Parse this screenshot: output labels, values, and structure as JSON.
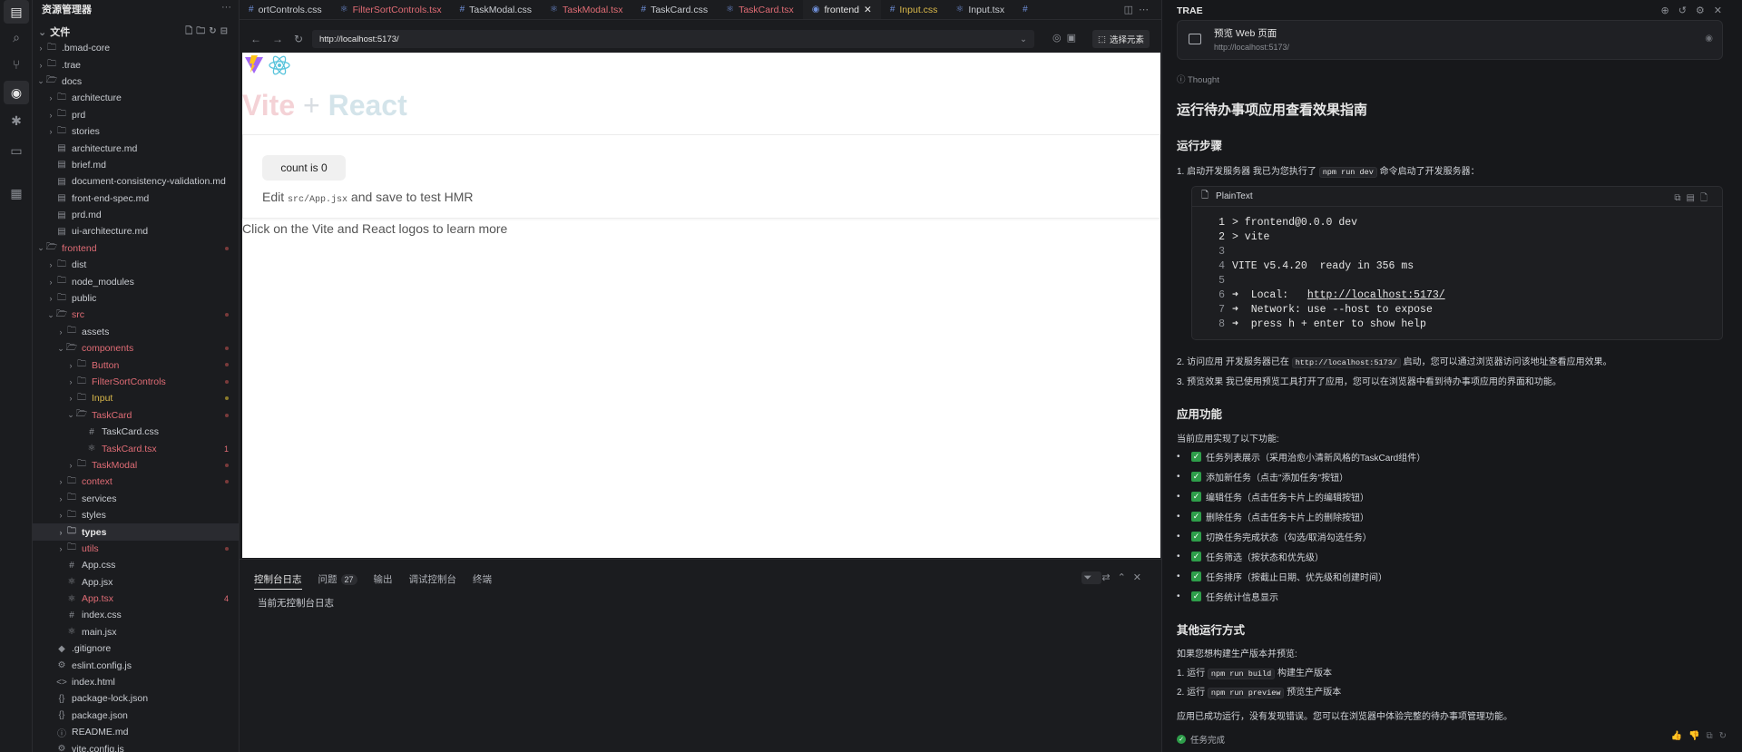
{
  "activity": {
    "icons": [
      "files-icon",
      "search-icon",
      "source-control-icon",
      "preview-eye-icon",
      "debug-icon",
      "remote-icon",
      "extensions-icon"
    ]
  },
  "sidebar": {
    "title": "资源管理器",
    "section": "文件",
    "items": [
      {
        "label": ".bmad-core",
        "indent": 0,
        "type": "folder"
      },
      {
        "label": ".trae",
        "indent": 0,
        "type": "folder"
      },
      {
        "label": "docs",
        "indent": 0,
        "type": "folder-open"
      },
      {
        "label": "architecture",
        "indent": 1,
        "type": "folder"
      },
      {
        "label": "prd",
        "indent": 1,
        "type": "folder"
      },
      {
        "label": "stories",
        "indent": 1,
        "type": "folder"
      },
      {
        "label": "architecture.md",
        "indent": 1,
        "type": "md"
      },
      {
        "label": "brief.md",
        "indent": 1,
        "type": "md"
      },
      {
        "label": "document-consistency-validation.md",
        "indent": 1,
        "type": "md"
      },
      {
        "label": "front-end-spec.md",
        "indent": 1,
        "type": "md"
      },
      {
        "label": "prd.md",
        "indent": 1,
        "type": "md"
      },
      {
        "label": "ui-architecture.md",
        "indent": 1,
        "type": "md"
      },
      {
        "label": "frontend",
        "indent": 0,
        "type": "folder-open",
        "color": "red",
        "dot": "r"
      },
      {
        "label": "dist",
        "indent": 1,
        "type": "folder"
      },
      {
        "label": "node_modules",
        "indent": 1,
        "type": "folder"
      },
      {
        "label": "public",
        "indent": 1,
        "type": "folder"
      },
      {
        "label": "src",
        "indent": 1,
        "type": "folder-open",
        "color": "red",
        "dot": "r"
      },
      {
        "label": "assets",
        "indent": 2,
        "type": "folder"
      },
      {
        "label": "components",
        "indent": 2,
        "type": "folder-open",
        "color": "red",
        "dot": "r"
      },
      {
        "label": "Button",
        "indent": 3,
        "type": "folder",
        "color": "red",
        "dot": "r"
      },
      {
        "label": "FilterSortControls",
        "indent": 3,
        "type": "folder",
        "color": "red",
        "dot": "r"
      },
      {
        "label": "Input",
        "indent": 3,
        "type": "folder",
        "color": "yellow",
        "dot": "y"
      },
      {
        "label": "TaskCard",
        "indent": 3,
        "type": "folder-open",
        "color": "red",
        "dot": "r"
      },
      {
        "label": "TaskCard.css",
        "indent": 4,
        "type": "css"
      },
      {
        "label": "TaskCard.tsx",
        "indent": 4,
        "type": "tsx",
        "color": "red",
        "num": "1"
      },
      {
        "label": "TaskModal",
        "indent": 3,
        "type": "folder",
        "color": "red",
        "dot": "r"
      },
      {
        "label": "context",
        "indent": 2,
        "type": "folder",
        "color": "red",
        "dot": "r"
      },
      {
        "label": "services",
        "indent": 2,
        "type": "folder"
      },
      {
        "label": "styles",
        "indent": 2,
        "type": "folder"
      },
      {
        "label": "types",
        "indent": 2,
        "type": "folder",
        "bold": true,
        "sel": true
      },
      {
        "label": "utils",
        "indent": 2,
        "type": "folder",
        "color": "red",
        "dot": "r"
      },
      {
        "label": "App.css",
        "indent": 2,
        "type": "css"
      },
      {
        "label": "App.jsx",
        "indent": 2,
        "type": "tsx"
      },
      {
        "label": "App.tsx",
        "indent": 2,
        "type": "tsx",
        "color": "red",
        "num": "4"
      },
      {
        "label": "index.css",
        "indent": 2,
        "type": "css"
      },
      {
        "label": "main.jsx",
        "indent": 2,
        "type": "tsx"
      },
      {
        "label": ".gitignore",
        "indent": 1,
        "type": "git"
      },
      {
        "label": "eslint.config.js",
        "indent": 1,
        "type": "js"
      },
      {
        "label": "index.html",
        "indent": 1,
        "type": "html"
      },
      {
        "label": "package-lock.json",
        "indent": 1,
        "type": "json"
      },
      {
        "label": "package.json",
        "indent": 1,
        "type": "json"
      },
      {
        "label": "README.md",
        "indent": 1,
        "type": "info"
      },
      {
        "label": "vite.config.js",
        "indent": 1,
        "type": "js"
      }
    ]
  },
  "tabs": [
    {
      "label": "ortControls.css",
      "color": "",
      "icon": "#"
    },
    {
      "label": "FilterSortControls.tsx",
      "color": "red",
      "icon": "⚛"
    },
    {
      "label": "TaskModal.css",
      "color": "",
      "icon": "#"
    },
    {
      "label": "TaskModal.tsx",
      "color": "red",
      "icon": "⚛"
    },
    {
      "label": "TaskCard.css",
      "color": "",
      "icon": "#"
    },
    {
      "label": "TaskCard.tsx",
      "color": "red",
      "icon": "⚛"
    },
    {
      "label": "frontend",
      "color": "active",
      "icon": "◉"
    },
    {
      "label": "Input.css",
      "color": "yellow",
      "icon": "#"
    },
    {
      "label": "Input.tsx",
      "color": "",
      "icon": "⚛"
    },
    {
      "label": "",
      "color": "",
      "icon": "#"
    }
  ],
  "browser": {
    "url": "http://localhost:5173/",
    "pick_label": "选择元素"
  },
  "page": {
    "title_vite": "Vite",
    "title_plus": "+",
    "title_react": "React",
    "count_label": "count is 0",
    "edit_pre": "Edit ",
    "edit_code": "src/App.jsx",
    "edit_post": " and save to test HMR",
    "learn": "Click on the Vite and React logos to learn more"
  },
  "panel": {
    "tabs": [
      "控制台日志",
      "问题",
      "输出",
      "调试控制台",
      "终端"
    ],
    "problems_count": "27",
    "empty": "当前无控制台日志"
  },
  "assistant": {
    "header": "TRAE",
    "preview_title": "预览 Web 页面",
    "preview_url": "http://localhost:5173/",
    "thought": "Thought",
    "h1": "运行待办事项应用查看效果指南",
    "h_steps": "运行步骤",
    "step1_pre": "1. 启动开发服务器 我已为您执行了 ",
    "step1_code": "npm run dev",
    "step1_post": " 命令启动了开发服务器：",
    "code_lang": "PlainText",
    "code_lines": [
      {
        "n": "1",
        "t": "> frontend@0.0.0 dev"
      },
      {
        "n": "2",
        "t": "> vite"
      },
      {
        "n": "3",
        "t": ""
      },
      {
        "n": "4",
        "t": "VITE v5.4.20  ready in 356 ms"
      },
      {
        "n": "5",
        "t": ""
      },
      {
        "n": "6",
        "t": "➜  Local:   ",
        "link": "http://localhost:5173/"
      },
      {
        "n": "7",
        "t": "➜  Network: use --host to expose"
      },
      {
        "n": "8",
        "t": "➜  press h + enter to show help"
      }
    ],
    "step2_pre": "2. 访问应用 开发服务器已在 ",
    "step2_code": "http://localhost:5173/",
    "step2_post": " 启动，您可以通过浏览器访问该地址查看应用效果。",
    "step3": "3. 预览效果 我已使用预览工具打开了应用，您可以在浏览器中看到待办事项应用的界面和功能。",
    "h_features": "应用功能",
    "features_intro": "当前应用实现了以下功能:",
    "features": [
      "任务列表展示（采用治愈小清新风格的TaskCard组件）",
      "添加新任务（点击\"添加任务\"按钮）",
      "编辑任务（点击任务卡片上的编辑按钮）",
      "删除任务（点击任务卡片上的删除按钮）",
      "切换任务完成状态（勾选/取消勾选任务）",
      "任务筛选（按状态和优先级）",
      "任务排序（按截止日期、优先级和创建时间）",
      "任务统计信息显示"
    ],
    "h_other": "其他运行方式",
    "other_intro": "如果您想构建生产版本并预览:",
    "o1_pre": "1. 运行 ",
    "o1_code": "npm run build",
    "o1_post": " 构建生产版本",
    "o2_pre": "2. 运行 ",
    "o2_code": "npm run preview",
    "o2_post": " 预览生产版本",
    "closing": "应用已成功运行，没有发现错误。您可以在浏览器中体验完整的待办事项管理功能。",
    "done": "任务完成"
  }
}
